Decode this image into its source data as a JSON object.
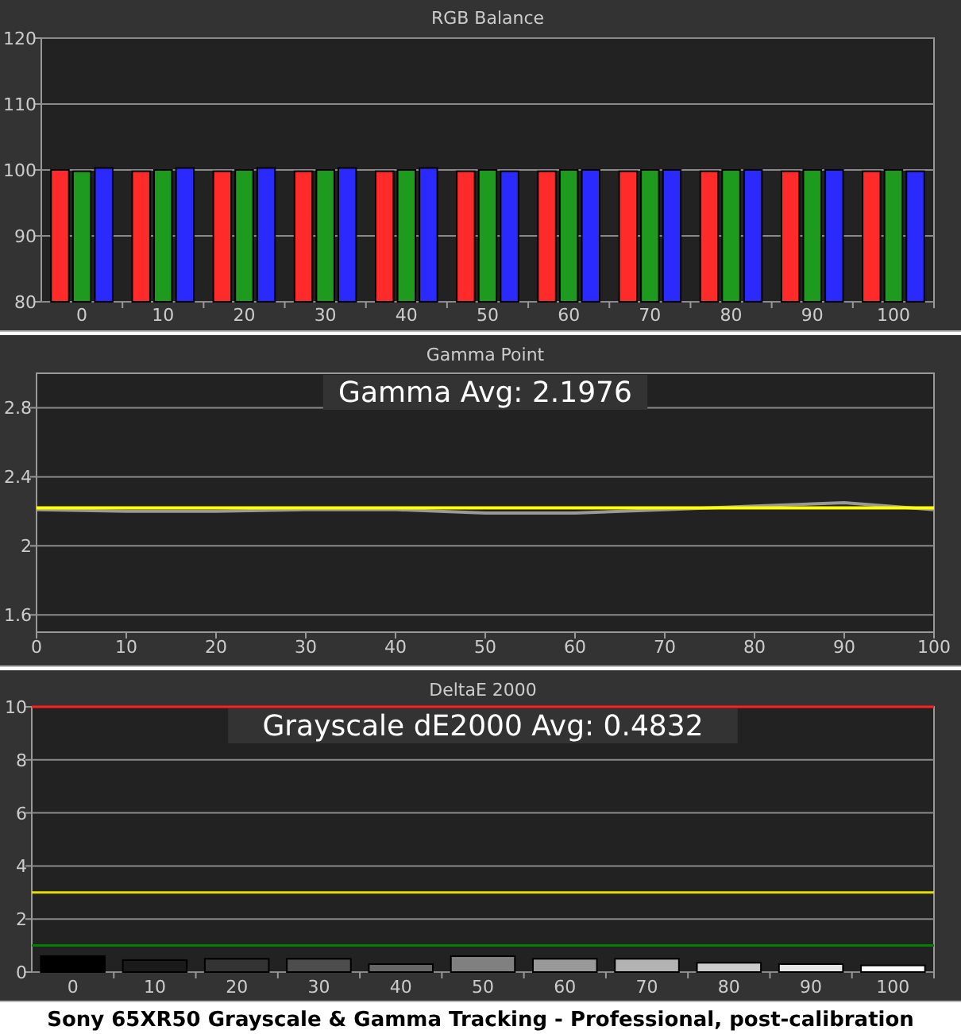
{
  "panels": [
    {
      "chart_data": {
        "type": "bar",
        "title": "RGB Balance",
        "categories": [
          "0",
          "10",
          "20",
          "30",
          "40",
          "50",
          "60",
          "70",
          "80",
          "90",
          "100"
        ],
        "ylim": [
          80,
          120
        ],
        "yticks": [
          80,
          90,
          100,
          110,
          120
        ],
        "grid": true,
        "series": [
          {
            "color": "#ff2a2a",
            "values": [
              100,
              99.8,
              99.8,
              99.8,
              99.8,
              99.8,
              99.8,
              99.8,
              99.8,
              99.8,
              99.8
            ]
          },
          {
            "color": "#1e9a1e",
            "values": [
              99.8,
              100,
              100,
              100,
              100,
              100,
              100,
              100,
              100,
              100,
              100
            ]
          },
          {
            "color": "#2a2aff",
            "values": [
              100.3,
              100.3,
              100.3,
              100.3,
              100.3,
              99.8,
              100,
              100,
              100,
              100,
              99.8
            ]
          }
        ]
      }
    },
    {
      "average_label": "Gamma Avg: 2.1976",
      "chart_data": {
        "type": "line",
        "title": "Gamma Point",
        "x": [
          0,
          10,
          20,
          30,
          40,
          50,
          60,
          70,
          80,
          90,
          100
        ],
        "xlim": [
          0,
          100
        ],
        "xticks": [
          0,
          10,
          20,
          30,
          40,
          50,
          60,
          70,
          80,
          90,
          100
        ],
        "ylim": [
          1.5,
          3.0
        ],
        "yticks": [
          1.6,
          2,
          2.4,
          2.8
        ],
        "grid": true,
        "series": [
          {
            "color": "#9a9a9a",
            "values": [
              2.21,
              2.2,
              2.2,
              2.21,
              2.21,
              2.19,
              2.19,
              2.21,
              2.23,
              2.25,
              2.21
            ]
          },
          {
            "color": "#ffff00",
            "values": [
              2.22,
              2.22,
              2.22,
              2.22,
              2.22,
              2.22,
              2.22,
              2.22,
              2.22,
              2.22,
              2.22
            ]
          }
        ]
      }
    },
    {
      "average_label": "Grayscale dE2000 Avg: 0.4832",
      "chart_data": {
        "type": "bar",
        "title": "DeltaE 2000",
        "categories": [
          "0",
          "10",
          "20",
          "30",
          "40",
          "50",
          "60",
          "70",
          "80",
          "90",
          "100"
        ],
        "ylim": [
          0,
          10
        ],
        "yticks": [
          0,
          2,
          4,
          6,
          8,
          10
        ],
        "series": [
          {
            "colors": [
              "#000000",
              "#1a1a1a",
              "#333333",
              "#4d4d4d",
              "#666666",
              "#808080",
              "#999999",
              "#b3b3b3",
              "#cccccc",
              "#e6e6e6",
              "#ffffff"
            ],
            "values": [
              0.6,
              0.45,
              0.5,
              0.5,
              0.3,
              0.6,
              0.5,
              0.5,
              0.35,
              0.3,
              0.25
            ]
          }
        ],
        "grid": true,
        "ref_lines": [
          {
            "axis": "y",
            "value": 10,
            "color": "#ff2020"
          },
          {
            "axis": "y",
            "value": 3,
            "color": "#e0e000"
          },
          {
            "axis": "y",
            "value": 1,
            "color": "#008000"
          }
        ]
      }
    }
  ],
  "caption": "Sony 65XR50 Grayscale & Gamma Tracking - Professional, post-calibration"
}
